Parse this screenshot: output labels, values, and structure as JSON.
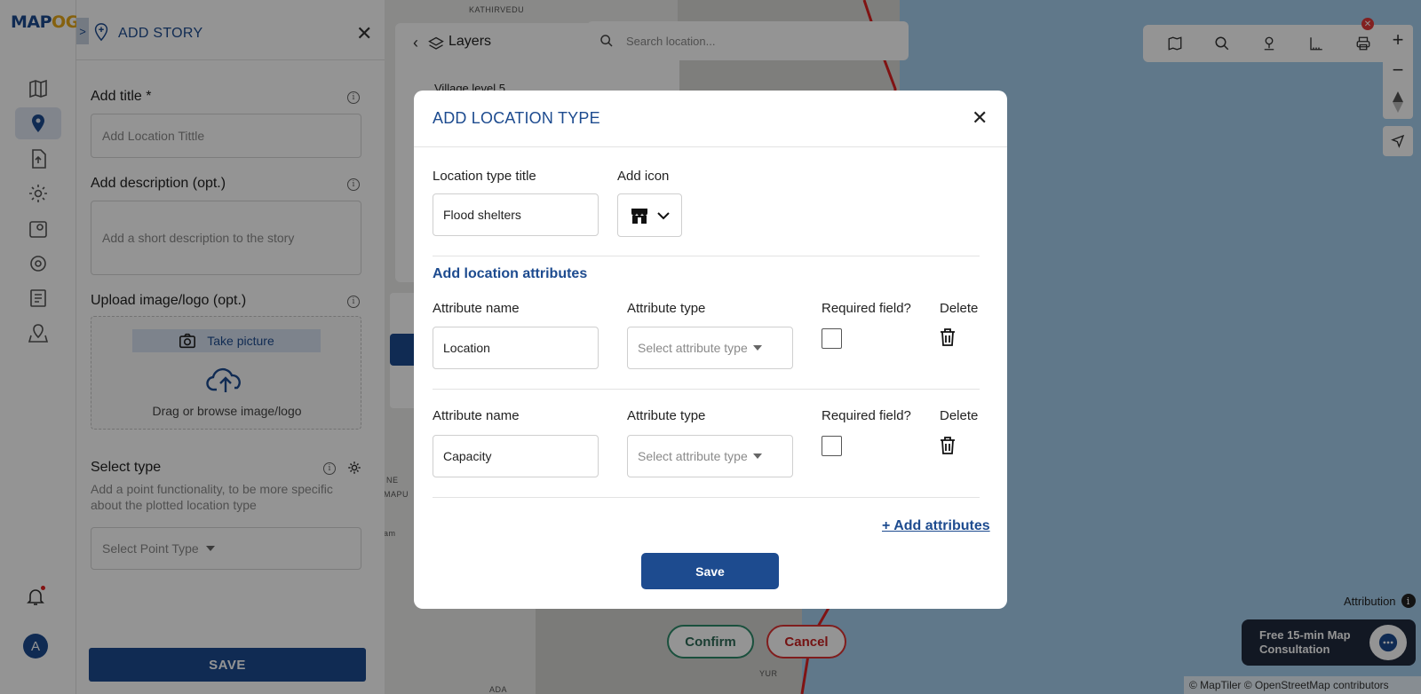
{
  "app": {
    "logo_text_main": "MAP",
    "logo_text_accent": "OG",
    "nav_icons": [
      "map-icon",
      "location-pin-icon",
      "file-upload-icon",
      "gear-icon",
      "map-pin-icon",
      "settings-icon",
      "report-icon",
      "map-location-icon"
    ],
    "notification_icon": "bell-icon",
    "avatar_letter": "A"
  },
  "story_panel": {
    "title": "ADD STORY",
    "collapse_glyph": ">",
    "close_glyph": "✕",
    "title_field": {
      "label": "Add title *",
      "placeholder": "Add Location Tittle"
    },
    "description_field": {
      "label": "Add description (opt.)",
      "placeholder": "Add a short description to the story"
    },
    "upload": {
      "label": "Upload image/logo (opt.)",
      "take_picture": "Take picture",
      "drag_text": "Drag or browse image/logo"
    },
    "select_type": {
      "label": "Select type",
      "description": "Add a point functionality, to be more specific about the plotted location type",
      "placeholder": "Select Point Type"
    },
    "save_label": "SAVE"
  },
  "map": {
    "layers_title": "Layers",
    "layer_item": "Village level 5",
    "search_placeholder": "Search location...",
    "toolbar_icons": [
      "map-view-icon",
      "search-icon",
      "pin-icon",
      "measure-icon",
      "print-icon"
    ],
    "labels": {
      "top": "KATHIRVEDU",
      "mid": "NE",
      "mid2": "MAPU",
      "left": "am",
      "bottom": "ADA",
      "bottom_right": "YUR"
    },
    "zoom_in": "+",
    "zoom_out": "−",
    "confirm_label": "Confirm",
    "cancel_label": "Cancel",
    "attribution_label": "Attribution",
    "consult_line1": "Free 15-min Map",
    "consult_line2": "Consultation",
    "copyright": "© MapTiler © OpenStreetMap contributors"
  },
  "modal": {
    "title": "ADD LOCATION TYPE",
    "close_glyph": "✕",
    "type_title_label": "Location type title",
    "type_title_value": "Flood shelters",
    "add_icon_label": "Add icon",
    "selected_icon": "store-icon",
    "attributes_section_title": "Add location attributes",
    "attributes": [
      {
        "name_label": "Attribute name",
        "name_value": "Location",
        "type_label": "Attribute type",
        "type_placeholder": "Select attribute type",
        "required_label": "Required field?",
        "required": false,
        "delete_label": "Delete"
      },
      {
        "name_label": "Attribute name",
        "name_value": "Capacity",
        "type_label": "Attribute type",
        "type_placeholder": "Select attribute type",
        "required_label": "Required field?",
        "required": false,
        "delete_label": "Delete"
      }
    ],
    "add_attributes_label": "+ Add attributes",
    "save_label": "Save"
  },
  "colors": {
    "brand_blue": "#1d4b8f",
    "accent_gold": "#e5a819",
    "confirm_green": "#2d8a6a",
    "cancel_red": "#c92222"
  }
}
